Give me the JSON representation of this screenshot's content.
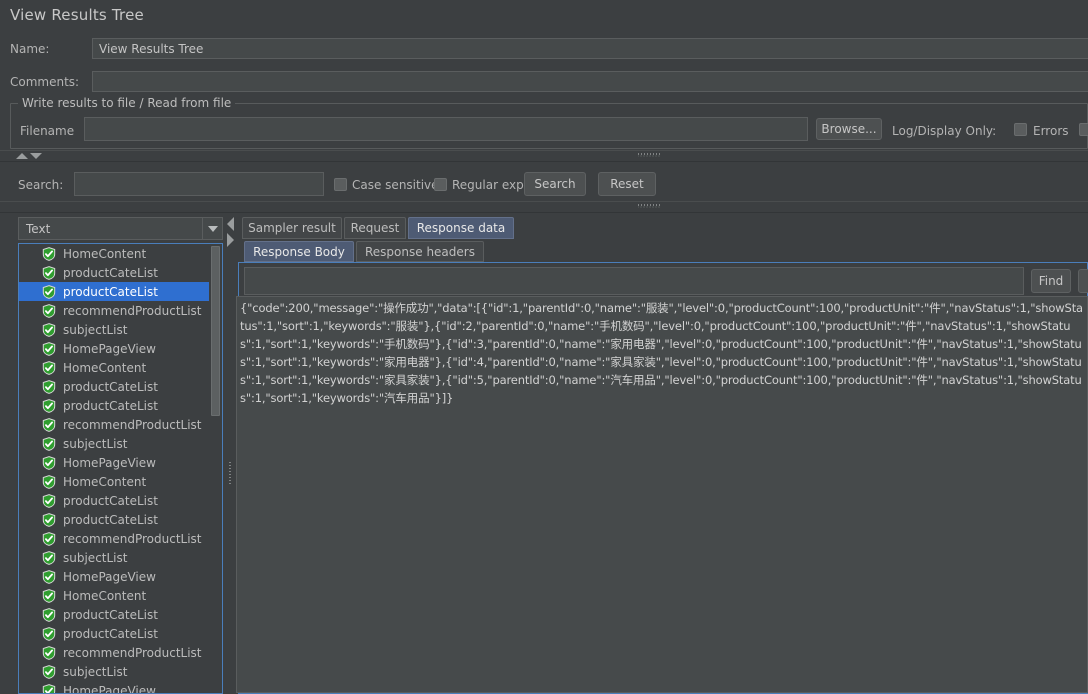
{
  "window": {
    "panel_title": "View Results Tree"
  },
  "form": {
    "name_label": "Name:",
    "name_value": "View Results Tree",
    "comments_label": "Comments:",
    "comments_value": "",
    "file_group_title": "Write results to file / Read from file",
    "filename_label": "Filename",
    "filename_value": "",
    "browse_label": "Browse...",
    "log_display_label": "Log/Display Only:",
    "errors_label": "Errors"
  },
  "search": {
    "label": "Search:",
    "value": "",
    "case_sensitive_label": "Case sensitive",
    "regular_exp_label": "Regular exp.",
    "search_button": "Search",
    "reset_button": "Reset"
  },
  "left_panel": {
    "renderer_selected": "Text",
    "renderer_options": [
      "Text"
    ],
    "tree_items": [
      {
        "label": "HomeContent",
        "status": "success",
        "selected": false
      },
      {
        "label": "productCateList",
        "status": "success",
        "selected": false
      },
      {
        "label": "productCateList",
        "status": "success",
        "selected": true
      },
      {
        "label": "recommendProductList",
        "status": "success",
        "selected": false
      },
      {
        "label": "subjectList",
        "status": "success",
        "selected": false
      },
      {
        "label": "HomePageView",
        "status": "success",
        "selected": false
      },
      {
        "label": "HomeContent",
        "status": "success",
        "selected": false
      },
      {
        "label": "productCateList",
        "status": "success",
        "selected": false
      },
      {
        "label": "productCateList",
        "status": "success",
        "selected": false
      },
      {
        "label": "recommendProductList",
        "status": "success",
        "selected": false
      },
      {
        "label": "subjectList",
        "status": "success",
        "selected": false
      },
      {
        "label": "HomePageView",
        "status": "success",
        "selected": false
      },
      {
        "label": "HomeContent",
        "status": "success",
        "selected": false
      },
      {
        "label": "productCateList",
        "status": "success",
        "selected": false
      },
      {
        "label": "productCateList",
        "status": "success",
        "selected": false
      },
      {
        "label": "recommendProductList",
        "status": "success",
        "selected": false
      },
      {
        "label": "subjectList",
        "status": "success",
        "selected": false
      },
      {
        "label": "HomePageView",
        "status": "success",
        "selected": false
      },
      {
        "label": "HomeContent",
        "status": "success",
        "selected": false
      },
      {
        "label": "productCateList",
        "status": "success",
        "selected": false
      },
      {
        "label": "productCateList",
        "status": "success",
        "selected": false
      },
      {
        "label": "recommendProductList",
        "status": "success",
        "selected": false
      },
      {
        "label": "subjectList",
        "status": "success",
        "selected": false
      },
      {
        "label": "HomePageView",
        "status": "success",
        "selected": false
      }
    ]
  },
  "right_panel": {
    "tabs": [
      {
        "label": "Sampler result",
        "active": false
      },
      {
        "label": "Request",
        "active": false
      },
      {
        "label": "Response data",
        "active": true
      }
    ],
    "subtabs": [
      {
        "label": "Response Body",
        "active": true
      },
      {
        "label": "Response headers",
        "active": false
      }
    ],
    "find_value": "",
    "find_button": "Find",
    "response_body": "{\"code\":200,\"message\":\"操作成功\",\"data\":[{\"id\":1,\"parentId\":0,\"name\":\"服装\",\"level\":0,\"productCount\":100,\"productUnit\":\"件\",\"navStatus\":1,\"showStatus\":1,\"sort\":1,\"keywords\":\"服装\"},{\"id\":2,\"parentId\":0,\"name\":\"手机数码\",\"level\":0,\"productCount\":100,\"productUnit\":\"件\",\"navStatus\":1,\"showStatus\":1,\"sort\":1,\"keywords\":\"手机数码\"},{\"id\":3,\"parentId\":0,\"name\":\"家用电器\",\"level\":0,\"productCount\":100,\"productUnit\":\"件\",\"navStatus\":1,\"showStatus\":1,\"sort\":1,\"keywords\":\"家用电器\"},{\"id\":4,\"parentId\":0,\"name\":\"家具家装\",\"level\":0,\"productCount\":100,\"productUnit\":\"件\",\"navStatus\":1,\"showStatus\":1,\"sort\":1,\"keywords\":\"家具家装\"},{\"id\":5,\"parentId\":0,\"name\":\"汽车用品\",\"level\":0,\"productCount\":100,\"productUnit\":\"件\",\"navStatus\":1,\"showStatus\":1,\"sort\":1,\"keywords\":\"汽车用品\"}]}"
  },
  "colors": {
    "background": "#3c3f41",
    "field_background": "#45494a",
    "selection_blue": "#2f6fd0",
    "tab_active": "#4e5b74",
    "focus_border": "#4a7ebb",
    "status_green": "#35a035",
    "text": "#bbbbbb"
  }
}
